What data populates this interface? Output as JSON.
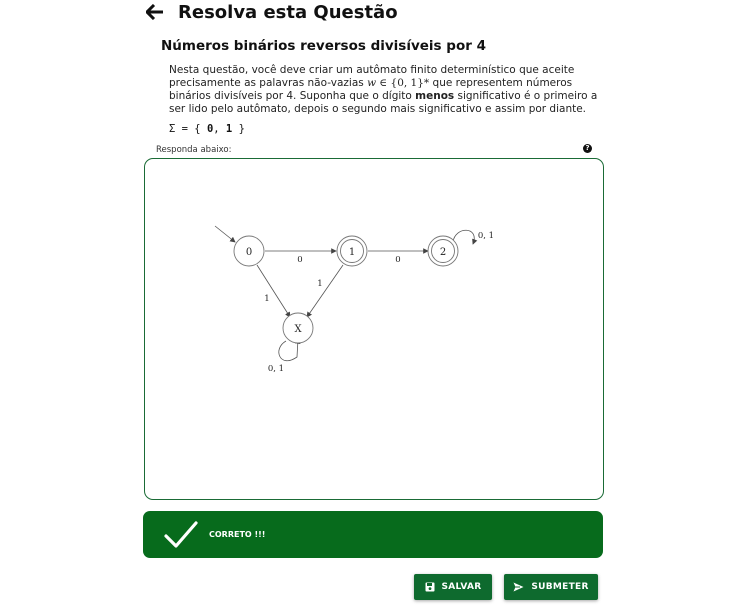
{
  "header": {
    "title": "Resolva esta Questão"
  },
  "question": {
    "title": "Números binários reversos divisíveis por 4",
    "desc_part1": "Nesta questão, você deve criar um autômato finito determinístico que aceite precisamente as palavras não-vazias ",
    "desc_math_w": "w",
    "desc_math_in": " ∈ {0, 1}*",
    "desc_part2": " que representem números binários divisíveis por 4. Suponha que o dígito ",
    "desc_bold": "menos",
    "desc_part3": " significativo é o primeiro a ser lido pelo autômato, depois o segundo mais significativo e assim por diante.",
    "alphabet_prefix": "Σ = { ",
    "alphabet_s0": "0",
    "alphabet_sep": ", ",
    "alphabet_s1": "1",
    "alphabet_suffix": " }"
  },
  "answer": {
    "label": "Responda abaixo:",
    "help_icon": "question-circle-icon"
  },
  "automaton": {
    "states": [
      {
        "id": "q0",
        "label": "0",
        "initial": true,
        "accepting": false
      },
      {
        "id": "q1",
        "label": "1",
        "initial": false,
        "accepting": true
      },
      {
        "id": "q2",
        "label": "2",
        "initial": false,
        "accepting": true
      },
      {
        "id": "qx",
        "label": "X",
        "initial": false,
        "accepting": false
      }
    ],
    "transitions": [
      {
        "from": "0",
        "to": "1",
        "label": "0"
      },
      {
        "from": "1",
        "to": "2",
        "label": "0"
      },
      {
        "from": "2",
        "to": "2",
        "label": "0, 1"
      },
      {
        "from": "0",
        "to": "X",
        "label": "1"
      },
      {
        "from": "1",
        "to": "X",
        "label": "1"
      },
      {
        "from": "X",
        "to": "X",
        "label": "0, 1"
      }
    ]
  },
  "feedback": {
    "text": "CORRETO !!!",
    "icon": "check-icon",
    "color": "#076b1c"
  },
  "actions": {
    "save_label": "SALVAR",
    "submit_label": "SUBMETER",
    "accent": "#0e6a2e"
  }
}
